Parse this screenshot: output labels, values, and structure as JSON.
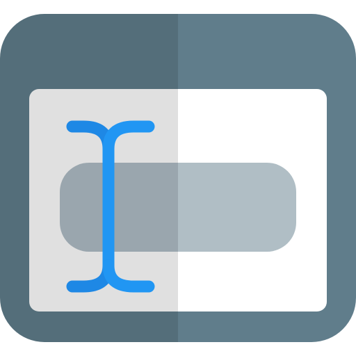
{
  "icon": {
    "name": "text-input-cursor-icon",
    "colors": {
      "frame_left": "#546E7A",
      "frame_right": "#607D8B",
      "panel_left": "#E0E0E0",
      "panel_right": "#FFFFFF",
      "field_left": "#9AA6AE",
      "field_right": "#B0BEC5",
      "cursor_left": "#1E88E5",
      "cursor_right": "#2196F3"
    }
  }
}
